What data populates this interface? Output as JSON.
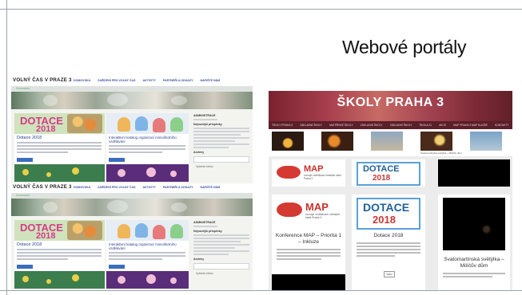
{
  "slide": {
    "title": "Webové portály"
  },
  "volny_cas_screenshot": {
    "logo": "VOLNÝ ČAS V PRAZE 3",
    "nav": [
      "DOMOVSKÁ",
      "ZAŘÍZENÍ PRO VOLNÝ ČAS",
      "AKTIVITY",
      "PARTNEŘI A ODKAZY",
      "NAPIŠTE NÁM"
    ],
    "subbar": "Domovská",
    "card1": {
      "banner_word": "DOTACE",
      "banner_year": "2018",
      "title": "Dotace 2018"
    },
    "card2": {
      "title": "Interaktivní katalog organizací mimoškolního vzdělávání"
    },
    "sidebar": {
      "heading1": "ADMINISTRACE",
      "heading2": "Nejnovější příspěvky",
      "heading3": "Archivy",
      "select": "Vyberte měsíc"
    }
  },
  "skoly_screenshot": {
    "header_title": "ŠKOLY PRAHA 3",
    "nav": [
      "ŠKOLY PRAHA 3",
      "ZÁKLADNÍ ŠKOLY",
      "MATEŘSKÉ ŠKOLY",
      "ZÁKLADNÍ ŠKOLY",
      "ZÁKLADNÍ ŠKOLY",
      "ŠKOLA 21",
      "AKCE",
      "MAP PRAHA 3 MAP KULÍŠE",
      "KONTAKTY"
    ],
    "thumb_caption": "Svatomartinská světýlka – Milíčův dům",
    "top_cards": {
      "map_word": "MAP",
      "map_sub": "rozvoje vzdělávání městské části Praha 3",
      "dotace_word": "DOTACE",
      "dotace_year": "2018"
    },
    "cards": [
      {
        "title": "Konference MAP – Priorita 1 – Inkluze",
        "map_word": "MAP",
        "map_sub": "rozvoje vzdělávání městské části Praha 3"
      },
      {
        "title": "Dotace 2018",
        "dotace_word": "DOTACE",
        "dotace_year": "2018",
        "button": "Další"
      },
      {
        "title": "Svatomartinská světýlka – Milíčův dům"
      }
    ]
  }
}
